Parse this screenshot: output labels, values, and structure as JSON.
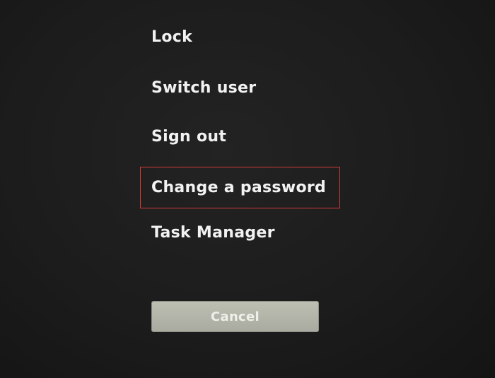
{
  "menu": {
    "items": [
      {
        "label": "Lock"
      },
      {
        "label": "Switch user"
      },
      {
        "label": "Sign out"
      },
      {
        "label": "Change a password"
      },
      {
        "label": "Task Manager"
      }
    ],
    "highlighted_item": "Change a password",
    "highlight_color": "#d23a3a"
  },
  "actions": {
    "cancel_label": "Cancel"
  },
  "colors": {
    "background": "#1b1b1b",
    "text": "#f2f2f2",
    "button": "#b4b6ab"
  }
}
